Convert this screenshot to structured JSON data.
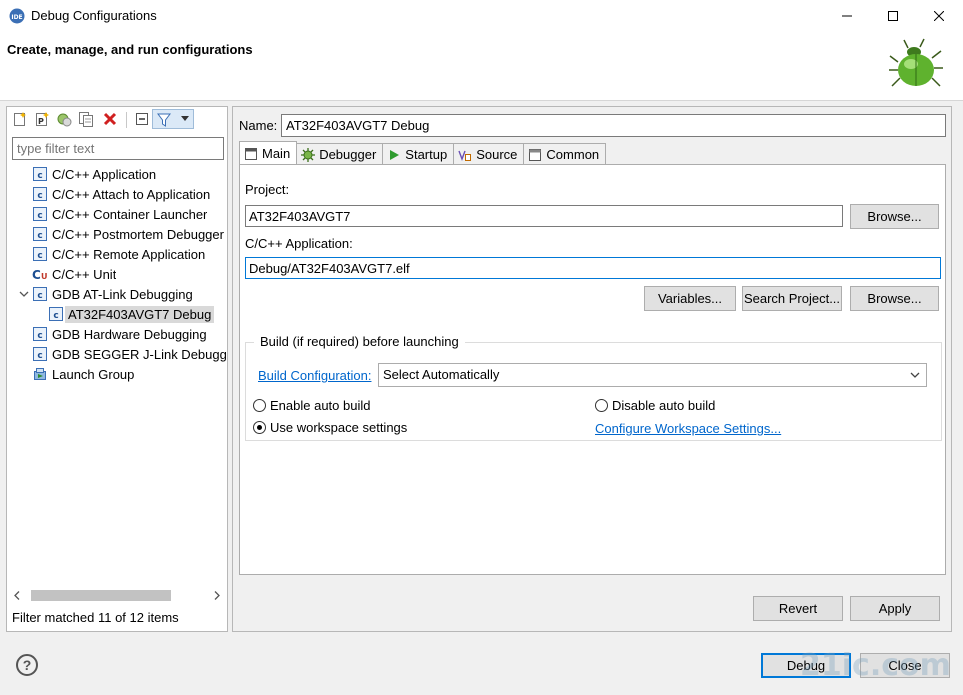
{
  "window": {
    "title": "Debug Configurations"
  },
  "header": {
    "text": "Create, manage, and run configurations"
  },
  "left": {
    "filter_placeholder": "type filter text",
    "tree": [
      {
        "label": "C/C++ Application"
      },
      {
        "label": "C/C++ Attach to Application"
      },
      {
        "label": "C/C++ Container Launcher"
      },
      {
        "label": "C/C++ Postmortem Debugger"
      },
      {
        "label": "C/C++ Remote Application"
      },
      {
        "label": "C/C++ Unit"
      },
      {
        "label": "GDB AT-Link Debugging"
      },
      {
        "label": "AT32F403AVGT7 Debug"
      },
      {
        "label": "GDB Hardware Debugging"
      },
      {
        "label": "GDB SEGGER J-Link Debugging"
      },
      {
        "label": "Launch Group"
      }
    ],
    "status": "Filter matched 11 of 12 items"
  },
  "main": {
    "name_label": "Name:",
    "name_value": "AT32F403AVGT7 Debug",
    "tabs": [
      {
        "label": "Main"
      },
      {
        "label": "Debugger"
      },
      {
        "label": "Startup"
      },
      {
        "label": "Source"
      },
      {
        "label": "Common"
      }
    ],
    "project_label": "Project:",
    "project_value": "AT32F403AVGT7",
    "browse_label": "Browse...",
    "app_label": "C/C++ Application:",
    "app_value": "Debug/AT32F403AVGT7.elf",
    "variables_label": "Variables...",
    "search_project_label": "Search Project...",
    "browse2_label": "Browse...",
    "build_group_title": "Build (if required) before launching",
    "build_config_link": "Build Configuration:",
    "build_config_value": "Select Automatically",
    "enable_auto_build": "Enable auto build",
    "disable_auto_build": "Disable auto build",
    "use_workspace": "Use workspace settings",
    "configure_workspace_link": "Configure Workspace Settings...",
    "revert_label": "Revert",
    "apply_label": "Apply"
  },
  "footer": {
    "debug_label": "Debug",
    "close_label": "Close",
    "help_glyph": "?",
    "watermark": "21ic.com"
  },
  "colors": {
    "accent": "#0078d7",
    "link": "#0066cc"
  }
}
